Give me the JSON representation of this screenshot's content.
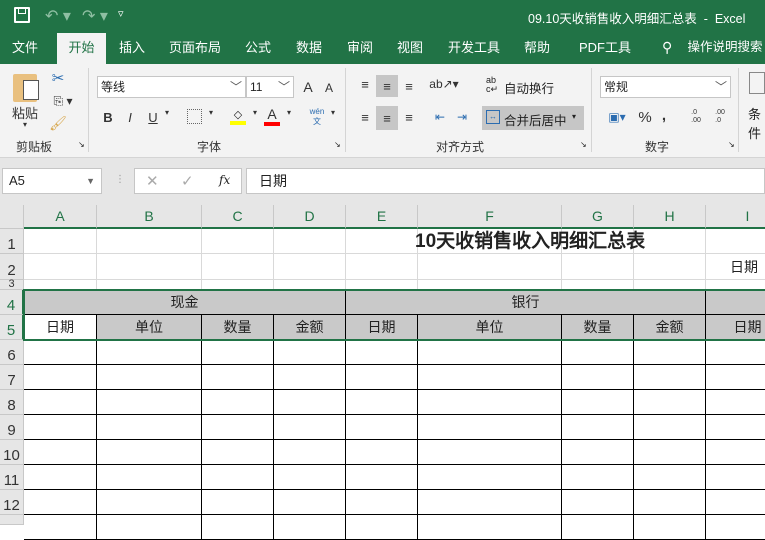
{
  "window": {
    "title": "09.10天收销售收入明细汇总表  -  Excel"
  },
  "tabs": [
    "文件",
    "开始",
    "插入",
    "页面布局",
    "公式",
    "数据",
    "审阅",
    "视图",
    "开发工具",
    "帮助",
    "PDF工具集"
  ],
  "tell_me": "操作说明搜索",
  "ribbon": {
    "clipboard": {
      "paste": "粘贴",
      "label": "剪贴板"
    },
    "font": {
      "name": "等线",
      "size": "11",
      "label": "字体",
      "bold": "B",
      "italic": "I",
      "underline": "U",
      "phonetic": "wén\n文",
      "grow": "A",
      "shrink": "A",
      "font_color": "A"
    },
    "alignment": {
      "wrap": "自动换行",
      "merge": "合并后居中",
      "label": "对齐方式"
    },
    "number": {
      "format": "常规",
      "percent": "%",
      "comma": ",",
      "label": "数字",
      "inc": ".0\n.00",
      "dec": ".00\n.0"
    },
    "styles": {
      "cond": "条件"
    }
  },
  "formula_bar": {
    "name_box": "A5",
    "content": "日期",
    "fx": "fx"
  },
  "columns": [
    "A",
    "B",
    "C",
    "D",
    "E",
    "F",
    "G",
    "H",
    "I"
  ],
  "rows": [
    "1",
    "2",
    "3",
    "4",
    "5",
    "6",
    "7",
    "8",
    "9",
    "10",
    "11",
    "12"
  ],
  "sheet": {
    "title": "10天收销售收入明细汇总表",
    "date_label": "日期",
    "group_cash": "现金",
    "group_bank": "银行",
    "headers": [
      "日期",
      "单位",
      "数量",
      "金额",
      "日期",
      "单位",
      "数量",
      "金额",
      "日期"
    ]
  },
  "colors": {
    "accent": "#217346",
    "header_fill": "#c9c9c9"
  }
}
